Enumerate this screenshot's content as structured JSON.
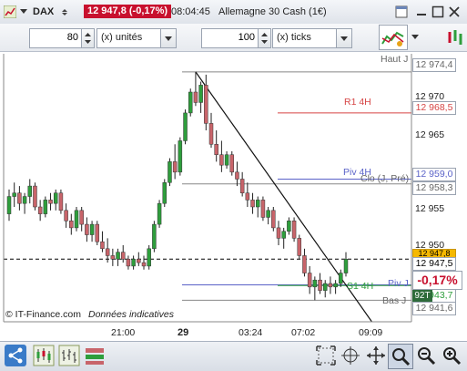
{
  "header": {
    "symbol": "DAX",
    "price_badge": "12 947,8 (-0,17%)",
    "time": "08:04:45",
    "instrument": "Allemagne 30 Cash (1€)"
  },
  "toolbar": {
    "units_value": "80",
    "units_label": "(x) unités",
    "ticks_value": "100",
    "ticks_label": "(x) ticks"
  },
  "chart": {
    "watermark": "© IT-Finance.com",
    "watermark_note": "Données indicatives",
    "levels": {
      "haut": "Haut J",
      "r1": "R1 4H",
      "piv4h": "Piv 4H",
      "cloj": "Clo (J, Pré)",
      "pivj": "Piv J",
      "s14h": "S1 4H",
      "basj": "Bas J"
    },
    "y_labels": [
      "12 970",
      "12 965",
      "12 955",
      "12 950"
    ],
    "y_boxes": {
      "haut": "12 974,4",
      "r1": "12 968,5",
      "piv4h": "12 959,0",
      "cloj": "12 958,3",
      "last": "12 947,5",
      "last_small": "12 947,8",
      "s1": "12 943,7",
      "bas": "12 941,6"
    },
    "change_badge": "-0,17%",
    "tag_92t": "92T",
    "x_labels": [
      "21:00",
      "29",
      "03:24",
      "07:02",
      "09:09"
    ],
    "colors": {
      "up": "#2e9e3c",
      "down": "#c8646a",
      "r1": "#d64545",
      "pivot": "#5a62c8",
      "support": "#2e9e3c",
      "neutral": "#888888"
    }
  },
  "chart_data": {
    "type": "candlestick",
    "candles": [
      [
        12954.0,
        12957.5,
        12953.0,
        12956.5
      ],
      [
        12956.5,
        12958.5,
        12955.0,
        12957.0
      ],
      [
        12957.0,
        12958.0,
        12954.5,
        12955.5
      ],
      [
        12955.5,
        12957.0,
        12954.0,
        12956.5
      ],
      [
        12956.5,
        12959.0,
        12955.5,
        12958.0
      ],
      [
        12958.0,
        12958.5,
        12954.5,
        12955.0
      ],
      [
        12955.0,
        12956.0,
        12953.0,
        12954.0
      ],
      [
        12954.0,
        12956.5,
        12953.5,
        12956.0
      ],
      [
        12956.0,
        12957.0,
        12954.5,
        12955.5
      ],
      [
        12955.5,
        12957.5,
        12954.5,
        12957.0
      ],
      [
        12957.0,
        12957.5,
        12954.0,
        12954.5
      ],
      [
        12954.5,
        12955.5,
        12952.0,
        12953.0
      ],
      [
        12953.0,
        12954.0,
        12951.0,
        12952.0
      ],
      [
        12952.0,
        12955.0,
        12951.5,
        12954.5
      ],
      [
        12954.5,
        12955.0,
        12951.5,
        12952.5
      ],
      [
        12952.5,
        12953.5,
        12950.0,
        12951.0
      ],
      [
        12951.0,
        12953.0,
        12950.0,
        12952.5
      ],
      [
        12952.5,
        12953.0,
        12949.5,
        12950.0
      ],
      [
        12950.0,
        12951.5,
        12948.5,
        12949.0
      ],
      [
        12949.0,
        12950.5,
        12947.0,
        12948.0
      ],
      [
        12948.0,
        12949.0,
        12946.5,
        12947.5
      ],
      [
        12947.5,
        12949.0,
        12946.5,
        12948.5
      ],
      [
        12948.5,
        12949.5,
        12947.0,
        12947.5
      ],
      [
        12947.5,
        12948.0,
        12946.0,
        12946.5
      ],
      [
        12946.5,
        12948.0,
        12946.0,
        12947.5
      ],
      [
        12947.5,
        12948.5,
        12946.5,
        12947.0
      ],
      [
        12947.0,
        12948.0,
        12946.0,
        12946.5
      ],
      [
        12946.5,
        12949.5,
        12946.0,
        12949.0
      ],
      [
        12949.0,
        12953.0,
        12948.5,
        12952.5
      ],
      [
        12952.5,
        12956.0,
        12952.0,
        12955.5
      ],
      [
        12955.5,
        12959.0,
        12955.0,
        12958.5
      ],
      [
        12958.5,
        12962.0,
        12958.0,
        12961.5
      ],
      [
        12961.5,
        12964.0,
        12959.0,
        12960.0
      ],
      [
        12960.0,
        12965.0,
        12959.5,
        12964.5
      ],
      [
        12964.5,
        12969.0,
        12964.0,
        12968.5
      ],
      [
        12968.5,
        12972.0,
        12968.0,
        12971.5
      ],
      [
        12971.5,
        12974.4,
        12969.5,
        12970.0
      ],
      [
        12970.0,
        12973.0,
        12968.5,
        12972.5
      ],
      [
        12972.5,
        12974.0,
        12966.0,
        12967.0
      ],
      [
        12967.0,
        12968.5,
        12963.5,
        12964.0
      ],
      [
        12964.0,
        12966.0,
        12961.5,
        12962.5
      ],
      [
        12962.5,
        12964.5,
        12960.0,
        12961.0
      ],
      [
        12961.0,
        12963.0,
        12960.5,
        12962.5
      ],
      [
        12962.5,
        12963.0,
        12959.5,
        12960.0
      ],
      [
        12960.0,
        12961.5,
        12958.0,
        12959.0
      ],
      [
        12959.0,
        12960.0,
        12956.5,
        12957.0
      ],
      [
        12957.0,
        12958.5,
        12955.0,
        12956.0
      ],
      [
        12956.0,
        12957.0,
        12954.0,
        12955.0
      ],
      [
        12955.0,
        12956.5,
        12953.5,
        12956.0
      ],
      [
        12956.0,
        12956.5,
        12953.0,
        12953.5
      ],
      [
        12953.5,
        12955.0,
        12952.5,
        12954.5
      ],
      [
        12954.5,
        12955.0,
        12951.5,
        12952.0
      ],
      [
        12952.0,
        12953.0,
        12949.5,
        12950.5
      ],
      [
        12950.5,
        12952.0,
        12949.0,
        12951.5
      ],
      [
        12951.5,
        12953.5,
        12951.0,
        12953.0
      ],
      [
        12953.0,
        12953.5,
        12950.0,
        12950.5
      ],
      [
        12950.5,
        12951.0,
        12947.5,
        12948.0
      ],
      [
        12948.0,
        12949.0,
        12945.0,
        12945.5
      ],
      [
        12945.5,
        12946.5,
        12942.5,
        12943.5
      ],
      [
        12943.5,
        12945.0,
        12941.6,
        12944.5
      ],
      [
        12944.5,
        12945.5,
        12942.5,
        12943.0
      ],
      [
        12943.0,
        12944.5,
        12942.0,
        12944.0
      ],
      [
        12944.0,
        12945.0,
        12942.5,
        12943.5
      ],
      [
        12943.5,
        12944.5,
        12942.5,
        12944.0
      ],
      [
        12944.0,
        12946.0,
        12943.5,
        12945.5
      ],
      [
        12945.5,
        12948.5,
        12945.0,
        12947.5
      ]
    ],
    "levels": {
      "haut_j": 12974.4,
      "r1_4h": 12968.5,
      "piv_4h": 12959.0,
      "clo_j_pre": 12958.3,
      "last": 12947.5,
      "piv_j": 12943.8,
      "s1_4h": 12943.7,
      "bas_j": 12941.6
    },
    "ylim": [
      12938.5,
      12977.0
    ],
    "y_ticks": [
      12950,
      12955,
      12965,
      12970
    ],
    "x_ticks": [
      "21:00",
      "29",
      "03:24",
      "07:02",
      "09:09"
    ],
    "trendline": [
      [
        12974.4,
        36
      ],
      [
        12938.5,
        70
      ]
    ]
  }
}
